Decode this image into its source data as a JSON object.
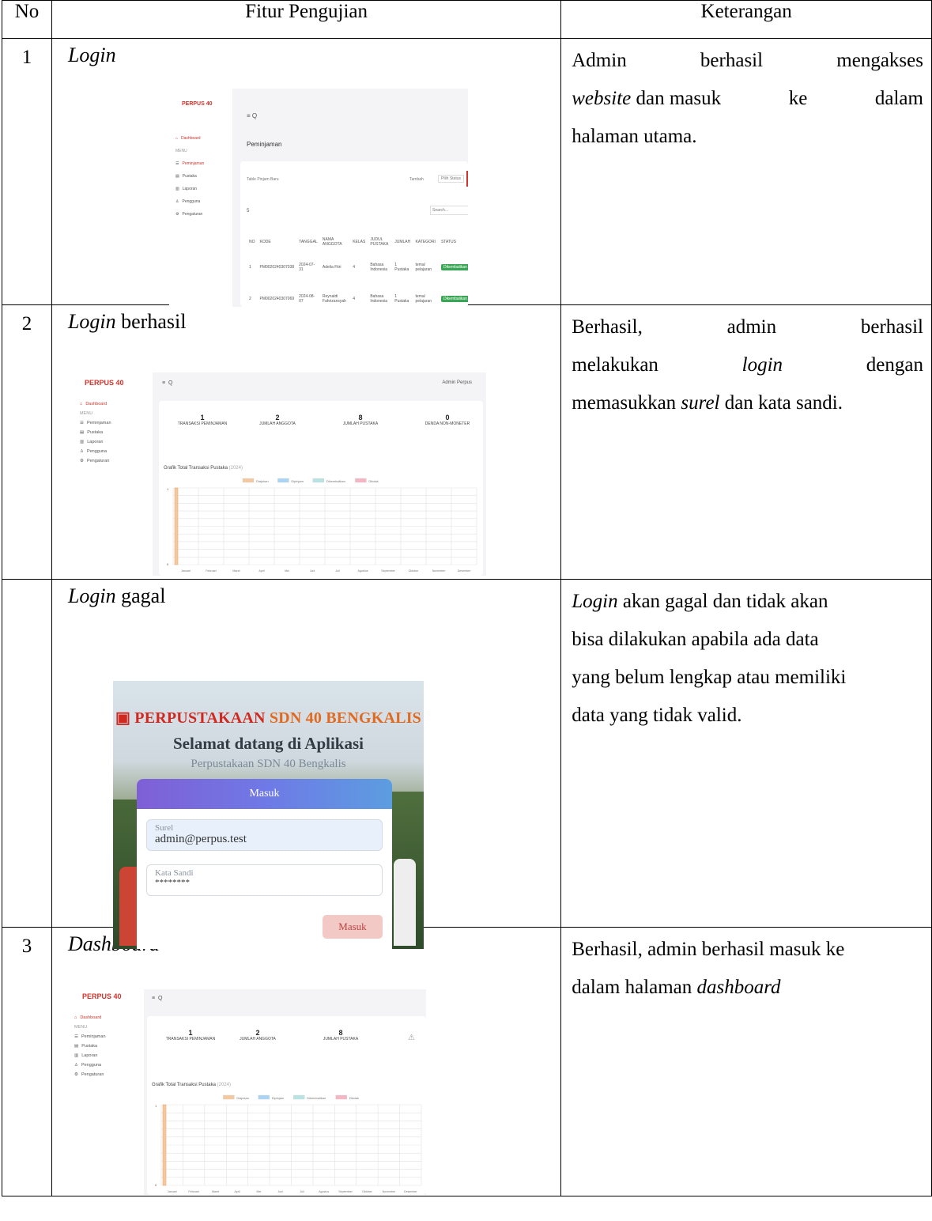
{
  "table": {
    "headers": {
      "no": "No",
      "feature": "Fitur Pengujian",
      "note": "Keterangan"
    },
    "rows": [
      {
        "no": "1",
        "feature": "Login",
        "note_parts": [
          "Admin",
          "berhasil",
          "mengakses",
          "website",
          "dan masuk",
          "ke",
          "dalam",
          "halaman utama."
        ]
      },
      {
        "no": "2",
        "feature_italic": "Login",
        "feature_rest": " berhasil",
        "note_parts": [
          "Berhasil,",
          "admin",
          "berhasil",
          "melakukan",
          "login",
          "dengan",
          "memasukkan",
          "surel",
          "dan kata sandi."
        ]
      },
      {
        "no": "",
        "feature_italic": "Login",
        "feature_rest": " gagal",
        "note_parts": [
          "Login",
          "akan gagal dan tidak akan",
          "bisa dilakukan apabila ada data",
          "yang belum lengkap atau memiliki",
          "data yang tidak valid."
        ]
      },
      {
        "no": "3",
        "feature": "Dashboard",
        "note_line1": "Berhasil, admin berhasil masuk ke",
        "note_line2_a": "dalam halaman ",
        "note_line2_b": "dashboard"
      }
    ]
  },
  "shot1": {
    "logo": "PERPUS 40",
    "top_icons": "≡  Q",
    "page_title": "Peminjaman",
    "side_items": [
      "Dashboard",
      "MENU",
      "Peminjaman",
      "Pustaka",
      "Laporan",
      "Pengguna",
      "Pengaturan"
    ],
    "toolbar_left": "Table Pinjam Baru",
    "toolbar_right_a": "Tambah",
    "toolbar_right_b": "Pilih Status",
    "per_page": "5",
    "search": "Search...",
    "cols": [
      "NO",
      "KODE",
      "TANGGAL",
      "NAMA ANGGOTA",
      "KELAS",
      "JUDUL PUSTAKA",
      "JUMLAH",
      "KATEGORI",
      "STATUS"
    ],
    "rows": [
      [
        "1",
        "PM0020240307038",
        "2024-07-31",
        "Adelia Fitri",
        "4",
        "Bahasa Indonesia",
        "1 Pustaka",
        "tema/ pelajaran",
        "Dikembalikan"
      ],
      [
        "2",
        "PM0020240307069",
        "2024-08-07",
        "Reynaldi Fahrizansyah",
        "4",
        "Bahasa Indonesia",
        "1 Pustaka",
        "tema/ pelajaran",
        "Dikembalikan"
      ]
    ]
  },
  "dash": {
    "logo": "PERPUS 40",
    "user": "Admin Perpus",
    "side_items": [
      "Dashboard",
      "MENU",
      "Peminjaman",
      "Pustaka",
      "Laporan",
      "Pengguna",
      "Pengaturan"
    ],
    "stats": [
      {
        "value": "1",
        "label": "TRANSAKSI PEMINJAMAN"
      },
      {
        "value": "2",
        "label": "JUMLAH ANGGOTA"
      },
      {
        "value": "8",
        "label": "JUMLAH PUSTAKA"
      },
      {
        "value": "0",
        "label": "DENDA NON-MONETER"
      }
    ],
    "chart_title": "Grafik Total Transaksi Pustaka",
    "chart_year": "(2024)",
    "legend": [
      "Diajukan",
      "Dipinjam",
      "Dikembalikan",
      "Ditolak"
    ],
    "months": [
      "Januari",
      "Februari",
      "Maret",
      "April",
      "Mei",
      "Juni",
      "Juli",
      "Agustus",
      "September",
      "Oktober",
      "November",
      "Desember"
    ],
    "y_ticks": [
      "1",
      "0"
    ]
  },
  "login": {
    "title_a": "PERPUSTAKAAN ",
    "title_b": "SDN 40 BENGKALIS",
    "welcome": "Selamat datang di Aplikasi",
    "sub": "Perpustakaan SDN 40 Bengkalis",
    "panel_title": "Masuk",
    "email_label": "Surel",
    "email_value": "admin@perpus.test",
    "password_label": "Kata Sandi",
    "password_value": "********",
    "button": "Masuk"
  },
  "chart_data": {
    "type": "bar",
    "title": "Grafik Total Transaksi Pustaka (2024)",
    "categories": [
      "Januari",
      "Februari",
      "Maret",
      "April",
      "Mei",
      "Juni",
      "Juli",
      "Agustus",
      "September",
      "Oktober",
      "November",
      "Desember"
    ],
    "series": [
      {
        "name": "Diajukan",
        "values": [
          1,
          0,
          0,
          0,
          0,
          0,
          0,
          0,
          0,
          0,
          0,
          0
        ]
      },
      {
        "name": "Dipinjam",
        "values": [
          0,
          0,
          0,
          0,
          0,
          0,
          0,
          0,
          0,
          0,
          0,
          0
        ]
      },
      {
        "name": "Dikembalikan",
        "values": [
          0,
          0,
          0,
          0,
          0,
          0,
          0,
          0,
          0,
          0,
          0,
          0
        ]
      },
      {
        "name": "Ditolak",
        "values": [
          0,
          0,
          0,
          0,
          0,
          0,
          0,
          0,
          0,
          0,
          0,
          0
        ]
      }
    ],
    "ylim": [
      0,
      1
    ],
    "legend_position": "top",
    "grid": true,
    "colors": [
      "#f5c9a0",
      "#a9d4f5",
      "#b9e3e3",
      "#f5b5c2"
    ]
  }
}
